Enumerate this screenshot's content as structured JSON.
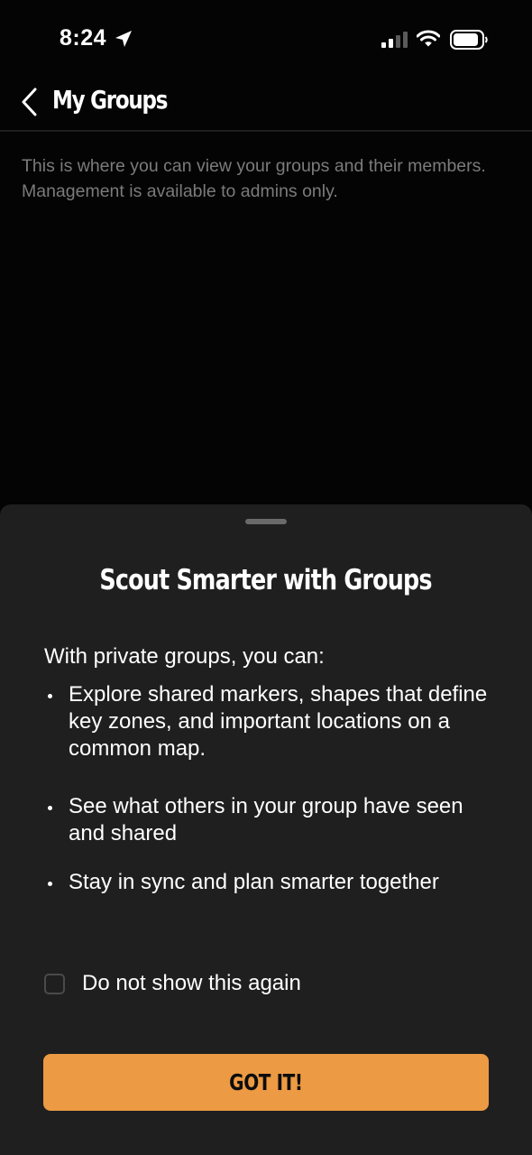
{
  "status_bar": {
    "time": "8:24",
    "icons": [
      "location-arrow-icon",
      "cellular-signal-icon",
      "wifi-icon",
      "battery-icon"
    ]
  },
  "header": {
    "back_icon": "chevron-left-icon",
    "title": "My Groups"
  },
  "main": {
    "description": "This is where you can view your groups and their members. Management is available to admins only."
  },
  "sheet": {
    "title": "Scout Smarter with Groups",
    "intro": "With private groups, you can:",
    "features": [
      "Explore shared markers, shapes that define key zones, and important locations on a common map.",
      "See what others in your group have seen and shared",
      "Stay in sync and plan smarter together"
    ],
    "checkbox_label": "Do not show this again",
    "checkbox_checked": false,
    "button_label": "GOT IT!"
  },
  "colors": {
    "background": "#040404",
    "sheet": "#1f1f1f",
    "accent": "#ec9a43",
    "muted_text": "#7b7b7b"
  }
}
